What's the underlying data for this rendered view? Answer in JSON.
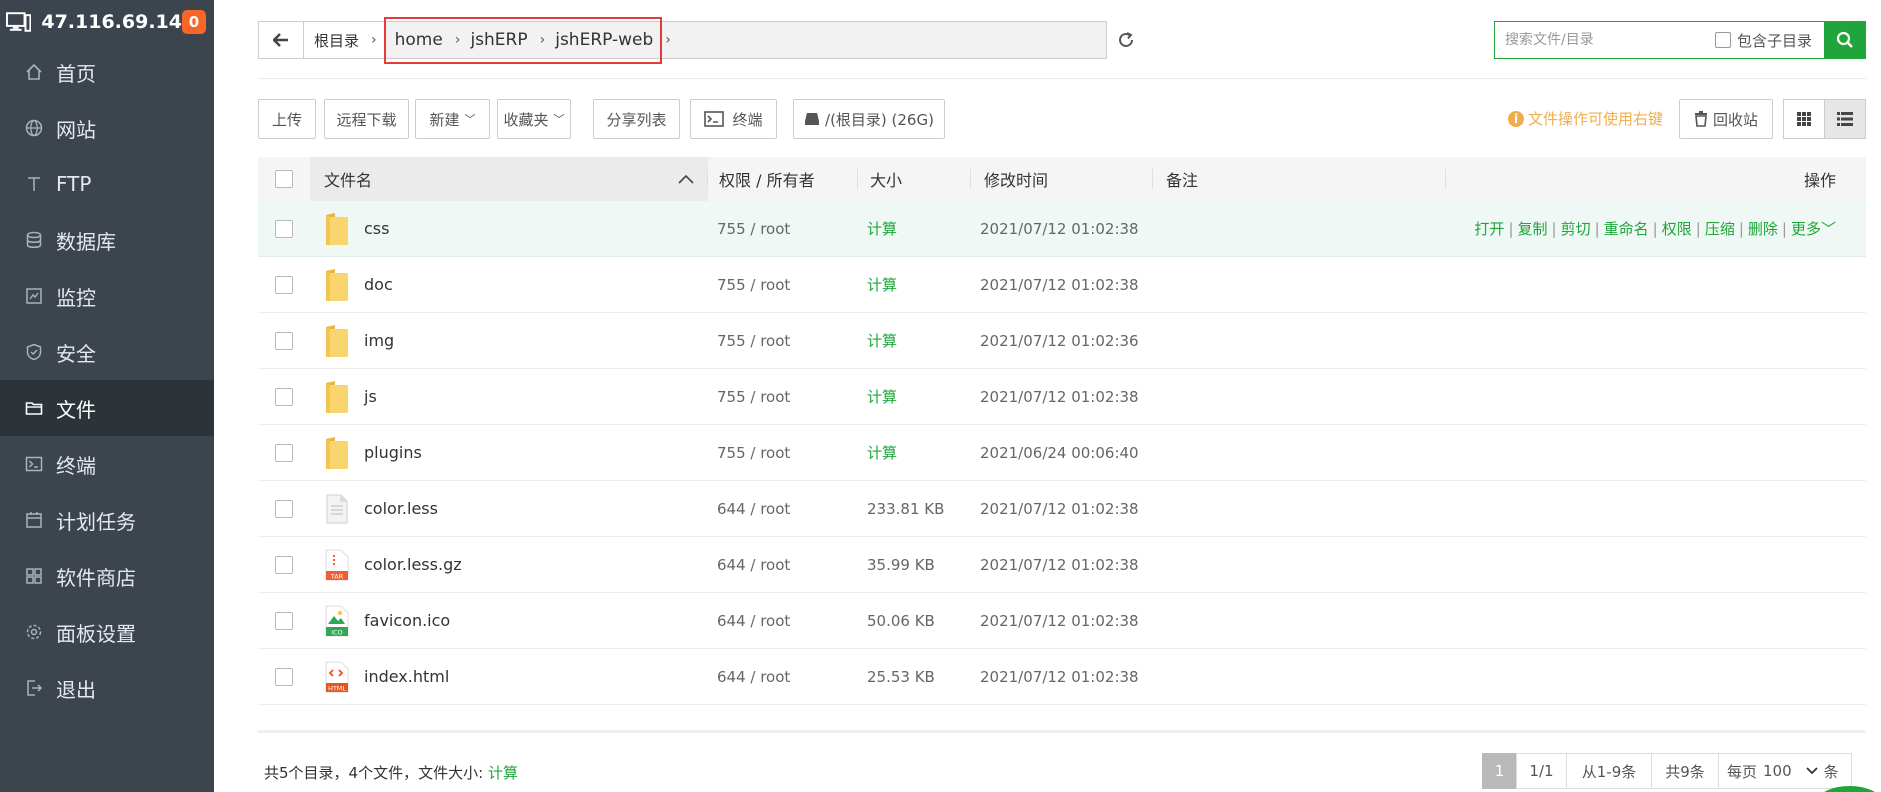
{
  "sidebar": {
    "server_ip": "47.116.69.14",
    "badge_count": "0",
    "items": [
      {
        "label": "首页",
        "icon": "home-icon"
      },
      {
        "label": "网站",
        "icon": "globe-icon"
      },
      {
        "label": "FTP",
        "icon": "ftp-icon"
      },
      {
        "label": "数据库",
        "icon": "database-icon"
      },
      {
        "label": "监控",
        "icon": "monitor-icon"
      },
      {
        "label": "安全",
        "icon": "shield-icon"
      },
      {
        "label": "文件",
        "icon": "folder-icon",
        "active": true
      },
      {
        "label": "终端",
        "icon": "terminal-icon"
      },
      {
        "label": "计划任务",
        "icon": "calendar-icon"
      },
      {
        "label": "软件商店",
        "icon": "apps-icon"
      },
      {
        "label": "面板设置",
        "icon": "settings-icon"
      },
      {
        "label": "退出",
        "icon": "logout-icon"
      }
    ]
  },
  "pathbar": {
    "root_label": "根目录",
    "crumbs": [
      "home",
      "jshERP",
      "jshERP-web"
    ]
  },
  "search": {
    "placeholder": "搜索文件/目录",
    "include_subdir_label": "包含子目录"
  },
  "toolbar": {
    "upload": "上传",
    "remote_download": "远程下载",
    "new": "新建",
    "favorites": "收藏夹",
    "share_list": "分享列表",
    "terminal": "终端",
    "disk": "/(根目录) (26G)",
    "tip": "文件操作可使用右键",
    "recycle_bin": "回收站"
  },
  "table": {
    "headers": {
      "name": "文件名",
      "perm": "权限 / 所有者",
      "size": "大小",
      "mtime": "修改时间",
      "note": "备注",
      "ops": "操作"
    },
    "row_ops": [
      "打开",
      "复制",
      "剪切",
      "重命名",
      "权限",
      "压缩",
      "删除",
      "更多"
    ],
    "rows": [
      {
        "name": "css",
        "type": "folder",
        "perm": "755 / root",
        "size": "计算",
        "mtime": "2021/07/12 01:02:38"
      },
      {
        "name": "doc",
        "type": "folder",
        "perm": "755 / root",
        "size": "计算",
        "mtime": "2021/07/12 01:02:38"
      },
      {
        "name": "img",
        "type": "folder",
        "perm": "755 / root",
        "size": "计算",
        "mtime": "2021/07/12 01:02:36"
      },
      {
        "name": "js",
        "type": "folder",
        "perm": "755 / root",
        "size": "计算",
        "mtime": "2021/07/12 01:02:38"
      },
      {
        "name": "plugins",
        "type": "folder",
        "perm": "755 / root",
        "size": "计算",
        "mtime": "2021/06/24 00:06:40"
      },
      {
        "name": "color.less",
        "type": "file",
        "perm": "644 / root",
        "size": "233.81 KB",
        "mtime": "2021/07/12 01:02:38"
      },
      {
        "name": "color.less.gz",
        "type": "tar",
        "icon_text": "TAR",
        "perm": "644 / root",
        "size": "35.99 KB",
        "mtime": "2021/07/12 01:02:38"
      },
      {
        "name": "favicon.ico",
        "type": "ico",
        "icon_text": "ICO",
        "perm": "644 / root",
        "size": "50.06 KB",
        "mtime": "2021/07/12 01:02:38"
      },
      {
        "name": "index.html",
        "type": "html",
        "icon_text": "HTML",
        "perm": "644 / root",
        "size": "25.53 KB",
        "mtime": "2021/07/12 01:02:38"
      }
    ]
  },
  "footer": {
    "summary_prefix": "共5个目录，4个文件，文件大小:",
    "summary_calc": "计算",
    "page_current": "1",
    "page_total": "1/1",
    "range": "从1-9条",
    "total": "共9条",
    "per_page_label": "每页",
    "per_page_value": "100",
    "per_page_unit": "条"
  },
  "colors": {
    "sidebar_bg": "#3c444d",
    "sidebar_active": "#2c3339",
    "accent_green": "#20a53a",
    "tip_orange": "#f0ad4e",
    "highlight_red": "#e53b3b",
    "folder_yellow": "#f9d56e"
  }
}
